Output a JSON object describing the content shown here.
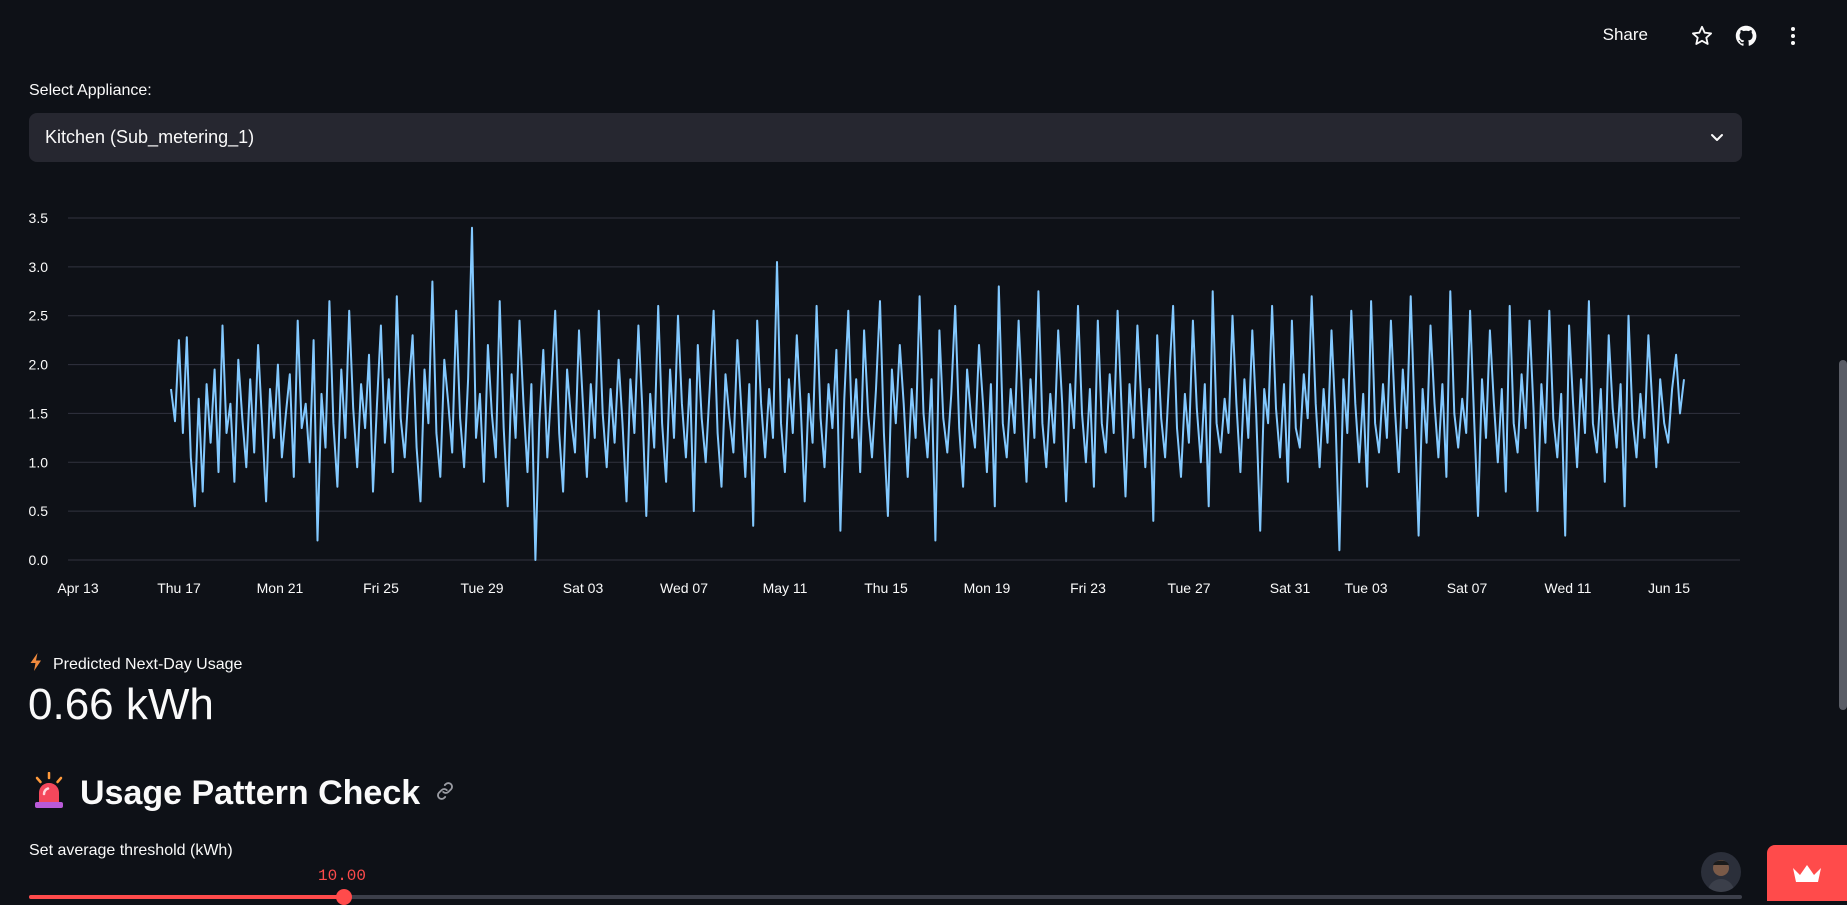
{
  "header": {
    "share_label": "Share",
    "icons": [
      "star-icon",
      "github-icon",
      "more-vertical-icon"
    ]
  },
  "appliance_select": {
    "label": "Select Appliance:",
    "selected": "Kitchen (Sub_metering_1)"
  },
  "chart_data": {
    "type": "line",
    "title": "",
    "xlabel": "",
    "ylabel": "",
    "ylim": [
      0,
      3.5
    ],
    "yticks": [
      "0.0",
      "0.5",
      "1.0",
      "1.5",
      "2.0",
      "2.5",
      "3.0",
      "3.5"
    ],
    "xticks": [
      "Apr 13",
      "Thu 17",
      "Mon 21",
      "Fri 25",
      "Tue 29",
      "Sat 03",
      "Wed 07",
      "May 11",
      "Thu 15",
      "Mon 19",
      "Fri 23",
      "Tue 27",
      "Sat 31",
      "Tue 03",
      "Sat 07",
      "Wed 11",
      "Jun 15"
    ],
    "grid": true,
    "series_color": "#83c9ff",
    "series": [
      {
        "values": [
          1.75,
          1.42,
          2.25,
          1.3,
          2.28,
          1.05,
          0.55,
          1.65,
          0.7,
          1.8,
          1.2,
          1.95,
          0.9,
          2.4,
          1.3,
          1.6,
          0.8,
          2.05,
          1.45,
          0.95,
          1.85,
          1.1,
          2.2,
          1.4,
          0.6,
          1.75,
          1.25,
          2.0,
          1.05,
          1.5,
          1.9,
          0.85,
          2.45,
          1.35,
          1.6,
          1.0,
          2.25,
          0.2,
          1.7,
          1.15,
          2.65,
          1.4,
          0.75,
          1.95,
          1.25,
          2.55,
          1.55,
          0.95,
          1.8,
          1.35,
          2.1,
          0.7,
          1.6,
          2.4,
          1.2,
          1.85,
          0.9,
          2.7,
          1.45,
          1.05,
          1.75,
          2.3,
          1.15,
          0.6,
          1.95,
          1.4,
          2.85,
          1.3,
          0.85,
          2.05,
          1.6,
          1.1,
          2.55,
          1.45,
          0.95,
          1.85,
          3.4,
          1.25,
          1.7,
          0.8,
          2.2,
          1.5,
          1.05,
          2.65,
          1.35,
          0.55,
          1.9,
          1.25,
          2.45,
          1.6,
          0.9,
          1.8,
          0.0,
          1.4,
          2.15,
          1.05,
          1.75,
          2.55,
          1.3,
          0.7,
          1.95,
          1.45,
          1.1,
          2.35,
          1.6,
          0.85,
          1.8,
          1.25,
          2.55,
          1.5,
          0.95,
          1.75,
          1.2,
          2.05,
          1.4,
          0.6,
          1.85,
          1.3,
          2.4,
          1.55,
          0.45,
          1.7,
          1.15,
          2.6,
          1.4,
          0.8,
          1.95,
          1.25,
          2.5,
          1.6,
          1.05,
          1.85,
          0.5,
          2.2,
          1.45,
          1.0,
          1.75,
          2.55,
          1.3,
          0.75,
          1.9,
          1.45,
          1.1,
          2.25,
          1.55,
          0.85,
          1.8,
          0.35,
          2.45,
          1.6,
          1.05,
          1.75,
          1.25,
          3.05,
          1.4,
          0.9,
          1.85,
          1.3,
          2.3,
          1.55,
          0.6,
          1.7,
          1.2,
          2.6,
          1.45,
          0.95,
          1.8,
          1.35,
          2.15,
          0.3,
          1.65,
          2.55,
          1.25,
          1.85,
          0.9,
          2.35,
          1.5,
          1.05,
          1.75,
          2.65,
          1.3,
          0.45,
          1.95,
          1.4,
          2.2,
          1.6,
          0.85,
          1.75,
          1.25,
          2.7,
          1.5,
          1.05,
          1.85,
          0.2,
          2.35,
          1.45,
          1.1,
          1.7,
          2.6,
          1.35,
          0.75,
          1.95,
          1.45,
          1.15,
          2.2,
          1.6,
          0.9,
          1.8,
          0.55,
          2.8,
          1.4,
          1.05,
          1.75,
          1.3,
          2.45,
          1.55,
          0.8,
          1.85,
          1.25,
          2.75,
          1.4,
          0.95,
          1.7,
          1.2,
          2.35,
          1.6,
          0.6,
          1.8,
          1.35,
          2.6,
          1.5,
          1.0,
          1.75,
          0.75,
          2.45,
          1.4,
          1.1,
          1.9,
          1.3,
          2.55,
          1.55,
          0.65,
          1.8,
          1.25,
          2.4,
          1.6,
          0.95,
          1.75,
          0.4,
          2.3,
          1.45,
          1.05,
          1.85,
          2.6,
          1.35,
          0.85,
          1.7,
          1.2,
          2.45,
          1.55,
          1.0,
          1.8,
          0.55,
          2.75,
          1.4,
          1.1,
          1.65,
          1.3,
          2.5,
          1.6,
          0.9,
          1.85,
          1.25,
          2.35,
          1.5,
          0.3,
          1.75,
          1.4,
          2.6,
          1.55,
          1.05,
          1.8,
          0.8,
          2.45,
          1.35,
          1.15,
          1.9,
          1.45,
          2.7,
          1.6,
          0.95,
          1.75,
          1.2,
          2.35,
          1.45,
          0.1,
          1.85,
          1.3,
          2.55,
          1.6,
          1.0,
          1.7,
          0.75,
          2.65,
          1.4,
          1.1,
          1.8,
          1.25,
          2.45,
          1.55,
          0.9,
          1.95,
          1.35,
          2.7,
          1.45,
          0.25,
          1.75,
          1.2,
          2.4,
          1.6,
          1.05,
          1.8,
          0.85,
          2.75,
          1.5,
          1.15,
          1.65,
          1.3,
          2.55,
          1.45,
          0.45,
          1.85,
          1.25,
          2.35,
          1.6,
          1.0,
          1.75,
          0.7,
          2.6,
          1.4,
          1.1,
          1.9,
          1.35,
          2.45,
          1.55,
          0.5,
          1.8,
          1.2,
          2.55,
          1.45,
          1.05,
          1.7,
          0.25,
          2.4,
          1.6,
          0.95,
          1.85,
          1.3,
          2.65,
          1.4,
          1.1,
          1.75,
          0.8,
          2.3,
          1.55,
          1.15,
          1.8,
          0.55,
          2.5,
          1.45,
          1.05,
          1.7,
          1.25,
          2.3,
          1.6,
          0.95,
          1.85,
          1.4,
          1.2,
          1.75,
          2.1,
          1.5,
          1.85
        ]
      }
    ]
  },
  "prediction": {
    "icon": "lightning-icon",
    "label": "Predicted Next-Day Usage",
    "value": "0.66 kWh"
  },
  "usage_section": {
    "icon": "alarm-light-icon",
    "title": "Usage Pattern Check",
    "threshold_label": "Set average threshold (kWh)",
    "slider_value": "10.00",
    "slider_fraction": 0.18
  },
  "colors": {
    "background": "#0e1117",
    "accent": "#ff4b4b",
    "line": "#83c9ff"
  }
}
